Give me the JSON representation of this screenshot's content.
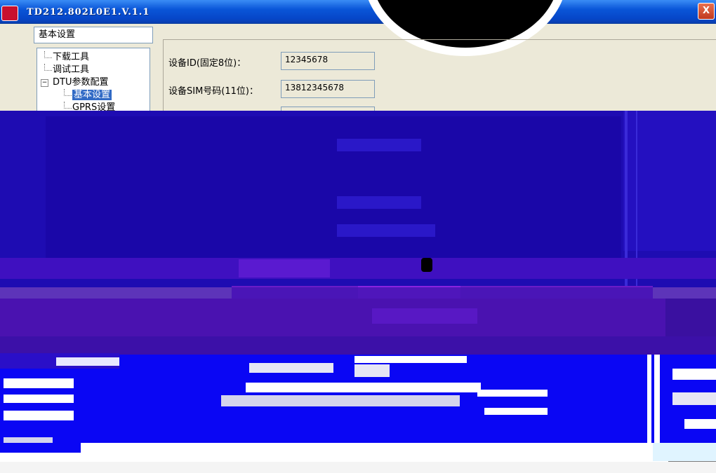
{
  "window": {
    "title": "TD212.802L0E1.V.1.1",
    "close_glyph": "X"
  },
  "left_panel": {
    "header": "基本设置",
    "tree": [
      {
        "label": "下载工具",
        "level": 0
      },
      {
        "label": "调试工具",
        "level": 0
      },
      {
        "label": "DTU参数配置",
        "level": 0,
        "expander": "−"
      },
      {
        "label": "基本设置",
        "level": 1,
        "selected": true
      },
      {
        "label": "GPRS设置",
        "level": 1
      }
    ]
  },
  "form": {
    "device_id_label": "设备ID(固定8位)：",
    "device_id_value": "12345678",
    "sim_label": "设备SIM号码(11位)：",
    "sim_value": "13812345678"
  },
  "colors": {
    "glitch_blue": "#1a08b8",
    "glitch_purple": "#5a14b8",
    "bright_blue": "#0000ff",
    "titlebar": "#0a56d8"
  }
}
